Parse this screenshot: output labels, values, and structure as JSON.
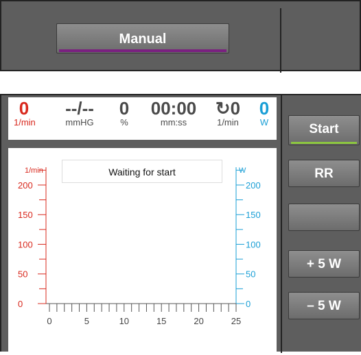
{
  "header": {
    "mode_label": "Manual"
  },
  "metrics": [
    {
      "value": "0",
      "unit": "1/min",
      "color": "#d8281d"
    },
    {
      "value": "--/--",
      "unit": "mmHG",
      "color": "#4a4a4a"
    },
    {
      "value": "0",
      "unit": "%",
      "color": "#4a4a4a"
    },
    {
      "value": "00:00",
      "unit": "mm:ss",
      "color": "#4a4a4a"
    },
    {
      "value": "0",
      "unit": "1/min",
      "icon": "refresh-icon",
      "color": "#4a4a4a"
    },
    {
      "value": "0",
      "unit": "W",
      "color": "#1a9fd6"
    }
  ],
  "status": "Waiting for start",
  "controls": {
    "start_label": "Start",
    "rr_label": "RR",
    "blank_label": "",
    "plus_label": "+ 5 W",
    "minus_label": "– 5 W"
  },
  "chart_data": {
    "type": "line",
    "left_axis": {
      "unit": "1/min",
      "color": "#d8281d",
      "ticks": [
        0,
        50,
        100,
        150,
        200
      ],
      "range": [
        0,
        230
      ]
    },
    "right_axis": {
      "unit": "W",
      "color": "#1a9fd6",
      "ticks": [
        0,
        50,
        100,
        150,
        200
      ],
      "range": [
        0,
        230
      ]
    },
    "x_axis": {
      "ticks": [
        0,
        5,
        10,
        15,
        20,
        25
      ],
      "range": [
        0,
        25
      ]
    },
    "series": []
  }
}
